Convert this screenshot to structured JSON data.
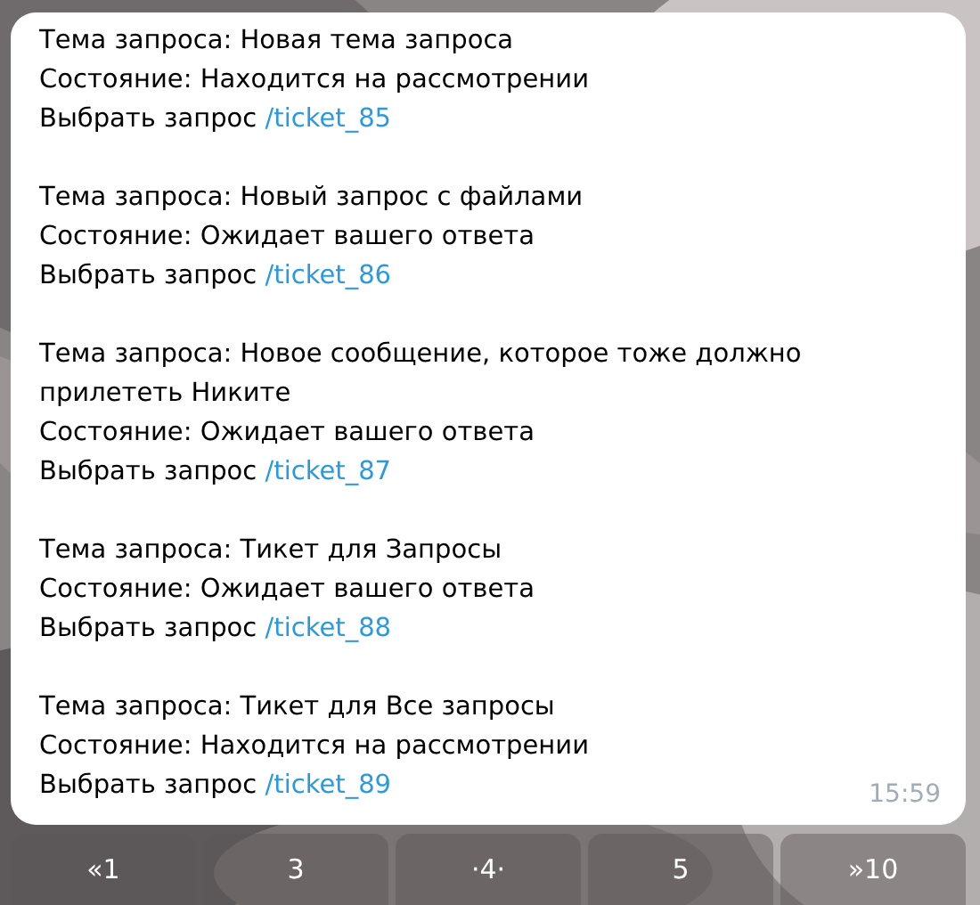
{
  "message": {
    "tickets": [
      {
        "topic": "Тема запроса: Новая тема запроса",
        "status": "Состояние: Находится на рассмотрении",
        "action": "Выбрать запрос",
        "command": "/ticket_85"
      },
      {
        "topic": "Тема запроса: Новый запрос с файлами",
        "status": "Состояние: Ожидает вашего ответа",
        "action": "Выбрать запрос",
        "command": "/ticket_86"
      },
      {
        "topic": "Тема запроса: Новое сообщение, которое тоже должно прилететь Никите",
        "status": "Состояние: Ожидает вашего ответа",
        "action": "Выбрать запрос",
        "command": "/ticket_87"
      },
      {
        "topic": "Тема запроса: Тикет для Запросы",
        "status": "Состояние: Ожидает вашего ответа",
        "action": "Выбрать запрос",
        "command": "/ticket_88"
      },
      {
        "topic": "Тема запроса: Тикет для Все запросы",
        "status": "Состояние: Находится на рассмотрении",
        "action": "Выбрать запрос",
        "command": "/ticket_89"
      }
    ],
    "time": "15:59"
  },
  "keyboard": [
    "«1",
    "3",
    "·4·",
    "5",
    "»10"
  ]
}
